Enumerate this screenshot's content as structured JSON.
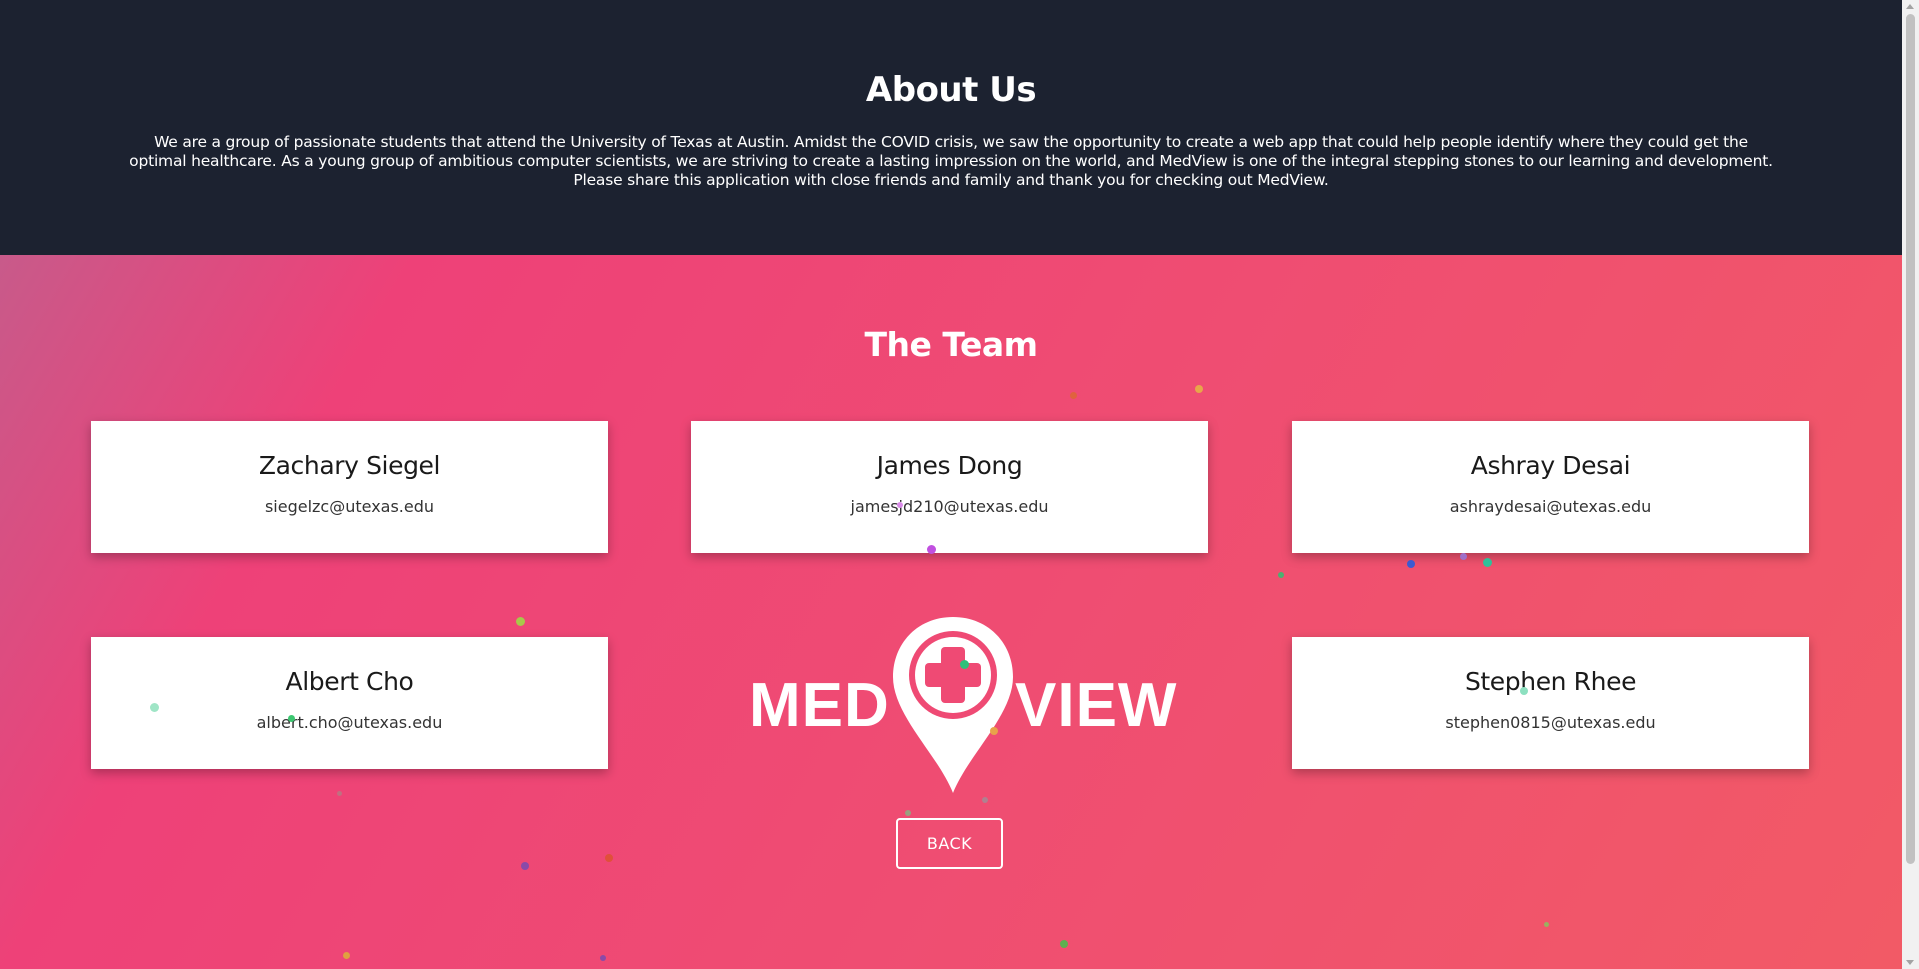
{
  "about": {
    "title": "About Us",
    "text": "We are a group of passionate students that attend the University of Texas at Austin. Amidst the COVID crisis, we saw the opportunity to create a web app that could help people identify where they could get the optimal healthcare. As a young group of ambitious computer scientists, we are striving to create a lasting impression on the world, and MedView is one of the integral stepping stones to our learning and development. Please share this application with close friends and family and thank you for checking out MedView."
  },
  "team": {
    "title": "The Team",
    "members": [
      {
        "name": "Zachary Siegel",
        "email": "siegelzc@utexas.edu"
      },
      {
        "name": "James Dong",
        "email": "jamesjd210@utexas.edu"
      },
      {
        "name": "Ashray Desai",
        "email": "ashraydesai@utexas.edu"
      },
      {
        "name": "Albert Cho",
        "email": "albert.cho@utexas.edu"
      },
      {
        "name": "Stephen Rhee",
        "email": "stephen0815@utexas.edu"
      }
    ]
  },
  "logo": {
    "left_text": "MED",
    "right_text": "VIEW",
    "icon": "map-pin-plus-icon"
  },
  "back_button": {
    "label": "BACK"
  },
  "colors": {
    "header_bg": "#1c2230",
    "gradient_start": "#ee4178",
    "gradient_end": "#f25a66",
    "card_bg": "#ffffff",
    "text_light": "#ffffff"
  }
}
